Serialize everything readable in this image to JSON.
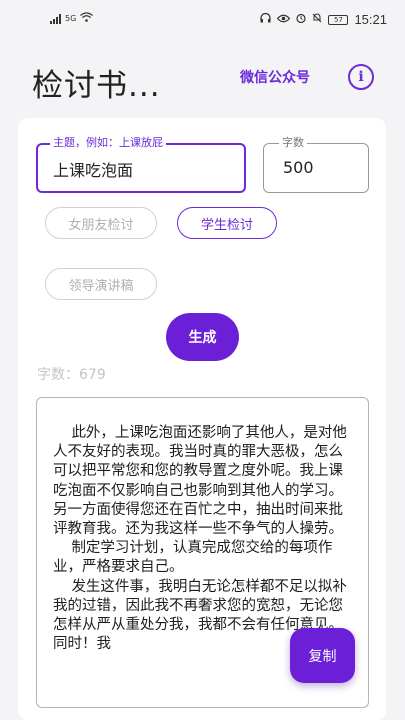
{
  "status_bar": {
    "network_label": "5G",
    "battery": "57",
    "time": "15:21"
  },
  "header": {
    "title": "检讨书...",
    "wechat_link": "微信公众号",
    "info_icon": "i"
  },
  "form": {
    "topic_label": "主题，例如：上课放屁",
    "topic_value": "上课吃泡面",
    "count_label": "字数",
    "count_value": "500"
  },
  "chips": [
    {
      "label": "女朋友检讨",
      "selected": false
    },
    {
      "label": "学生检讨",
      "selected": true
    },
    {
      "label": "领导演讲稿",
      "selected": false
    }
  ],
  "generate_label": "生成",
  "word_count": "字数：679",
  "essay": "    此外，上课吃泡面还影响了其他人，是对他人不友好的表现。我当时真的罪大恶极，怎么可以把平常您和您的教导置之度外呢。我上课吃泡面不仅影响自己也影响到其他人的学习。另一方面使得您还在百忙之中，抽出时间来批评教育我。还为我这样一些不争气的人操劳。\n    制定学习计划，认真完成您交给的每项作业，严格要求自己。\n    发生这件事，我明白无论怎样都不足以拟补我的过错，因此我不再奢求您的宽恕，无论您怎样从严从重处分我，我都不会有任何意见。同时！我",
  "copy_label": "复制",
  "colors": {
    "accent": "#6b2bd8",
    "button": "#6b1fd6"
  }
}
